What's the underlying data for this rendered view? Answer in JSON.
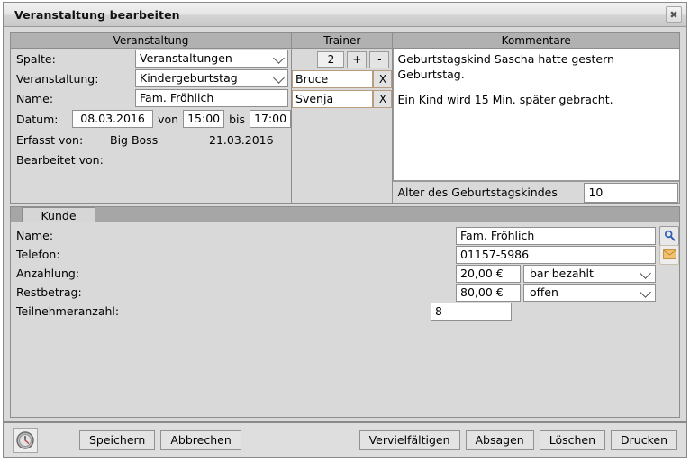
{
  "window": {
    "title": "Veranstaltung bearbeiten",
    "close_label": "✖"
  },
  "panels": {
    "veranstaltung": {
      "header": "Veranstaltung",
      "fields": {
        "spalte_label": "Spalte:",
        "spalte_value": "Veranstaltungen",
        "veranstaltung_label": "Veranstaltung:",
        "veranstaltung_value": "Kindergeburtstag",
        "name_label": "Name:",
        "name_value": "Fam. Fröhlich",
        "datum_label": "Datum:",
        "datum_value": "08.03.2016",
        "von_label": "von",
        "von_value": "15:00",
        "bis_label": "bis",
        "bis_value": "17:00",
        "erfasst_label": "Erfasst von:",
        "erfasst_user": "Big Boss",
        "erfasst_date": "21.03.2016",
        "bearbeitet_label": "Bearbeitet von:",
        "bearbeitet_user": ""
      }
    },
    "trainer": {
      "header": "Trainer",
      "count": "2",
      "add_label": "+",
      "remove_label": "-",
      "rows": [
        {
          "name": "Bruce",
          "delete_label": "X"
        },
        {
          "name": "Svenja",
          "delete_label": "X"
        }
      ]
    },
    "kommentare": {
      "header": "Kommentare",
      "line1": "Geburtstagskind Sascha hatte gestern Geburtstag.",
      "line2": "Ein Kind wird 15 Min. später gebracht.",
      "age_label": "Alter des Geburtstagskindes",
      "age_value": "10"
    }
  },
  "kunde": {
    "tab_label": "Kunde",
    "name_label": "Name:",
    "name_value": "Fam. Fröhlich",
    "telefon_label": "Telefon:",
    "telefon_value": "01157-5986",
    "anzahlung_label": "Anzahlung:",
    "anzahlung_value": "20,00 €",
    "anzahlung_status": "bar bezahlt",
    "restbetrag_label": "Restbetrag:",
    "restbetrag_value": "80,00 €",
    "restbetrag_status": "offen",
    "teilnehmer_label": "Teilnehmeranzahl:",
    "teilnehmer_value": "8",
    "search_icon": "magnifier-icon",
    "mail_icon": "envelope-icon"
  },
  "buttons": {
    "clock_icon": "clock-icon",
    "speichern": "Speichern",
    "abbrechen": "Abbrechen",
    "vervielfaeltigen": "Vervielfältigen",
    "absagen": "Absagen",
    "loeschen": "Löschen",
    "drucken": "Drucken"
  },
  "colors": {
    "panel_header": "#b1b1b1",
    "window_bg": "#d9d9d9",
    "tabstrip": "#a6a6a6",
    "search_icon": "#2f5fb5",
    "mail_icon": "#e8a33d"
  }
}
